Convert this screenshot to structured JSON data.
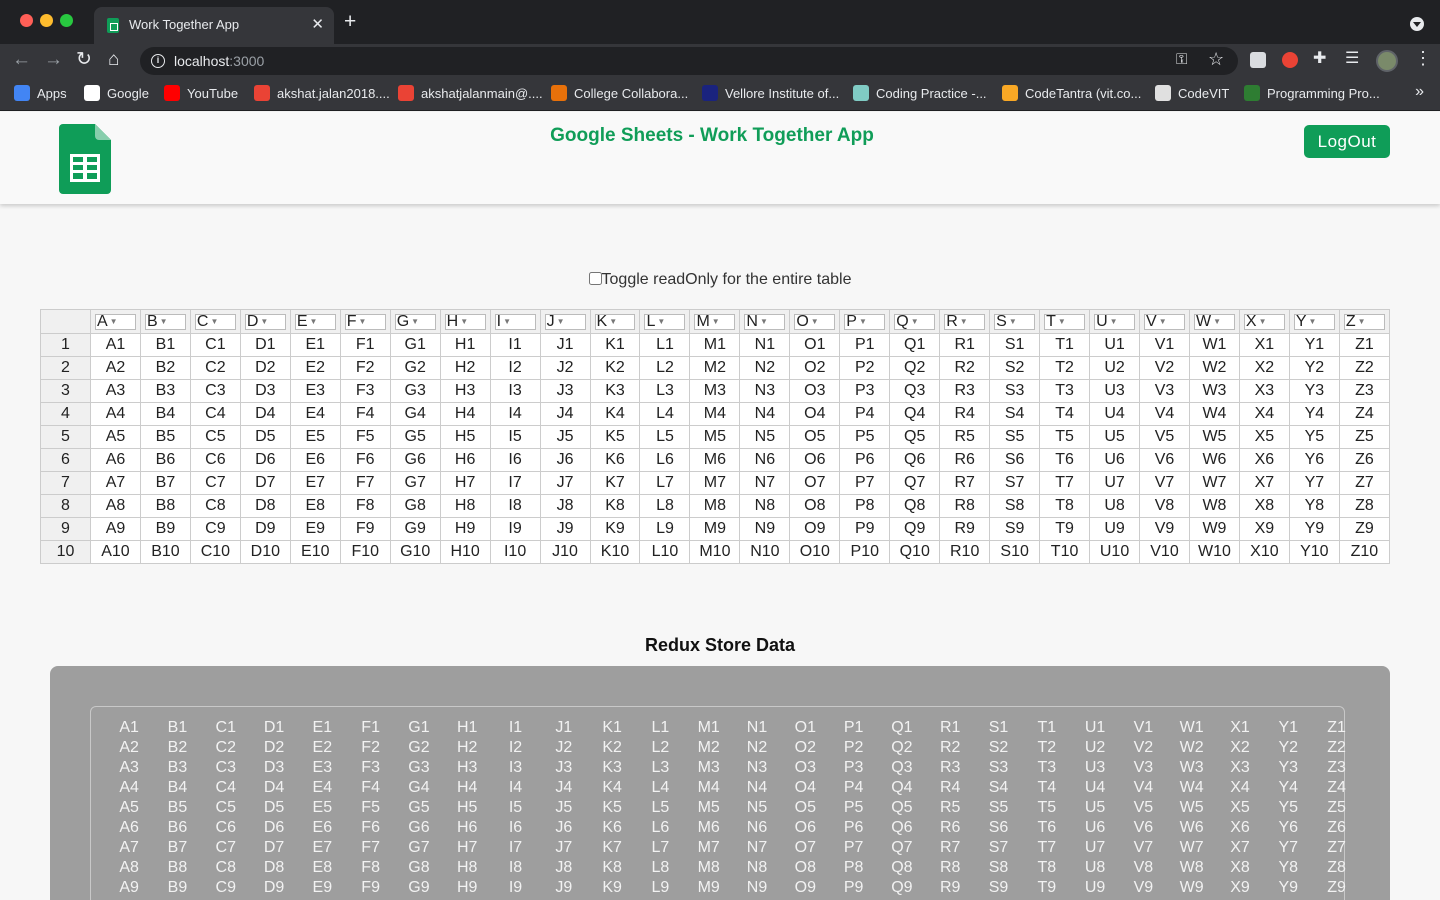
{
  "browser": {
    "tab_title": "Work Together App",
    "tab_close": "✕",
    "new_tab": "+",
    "url_host": "localhost",
    "url_port": ":3000",
    "bookmarks": [
      {
        "label": "Apps",
        "color": "#4285f4"
      },
      {
        "label": "Google",
        "color": "#ffffff"
      },
      {
        "label": "YouTube",
        "color": "#ff0000"
      },
      {
        "label": "akshat.jalan2018....",
        "color": "#ea4335"
      },
      {
        "label": "akshatjalanmain@....",
        "color": "#ea4335"
      },
      {
        "label": "College Collabora...",
        "color": "#e8710a"
      },
      {
        "label": "Vellore Institute of...",
        "color": "#1a237e"
      },
      {
        "label": "Coding Practice -...",
        "color": "#80cbc4"
      },
      {
        "label": "CodeTantra (vit.co...",
        "color": "#f9a825"
      },
      {
        "label": "CodeVIT",
        "color": "#e0e0e0"
      },
      {
        "label": "Programming Pro...",
        "color": "#2e7d32"
      }
    ],
    "bookmarks_more": "»"
  },
  "header": {
    "title": "Google Sheets - Work Together App",
    "logout_label": "LogOut",
    "brand_color": "#0f9d58"
  },
  "toggle": {
    "label": "Toggle readOnly for the entire table",
    "checked": false
  },
  "sheet": {
    "columns": [
      "A",
      "B",
      "C",
      "D",
      "E",
      "F",
      "G",
      "H",
      "I",
      "J",
      "K",
      "L",
      "M",
      "N",
      "O",
      "P",
      "Q",
      "R",
      "S",
      "T",
      "U",
      "V",
      "W",
      "X",
      "Y",
      "Z"
    ],
    "rows": [
      "1",
      "2",
      "3",
      "4",
      "5",
      "6",
      "7",
      "8",
      "9",
      "10"
    ],
    "dropdown_arrow": "▼"
  },
  "redux": {
    "title": "Redux Store Data",
    "visible_rows": [
      "1",
      "2",
      "3",
      "4",
      "5",
      "6",
      "7",
      "8",
      "9"
    ]
  }
}
